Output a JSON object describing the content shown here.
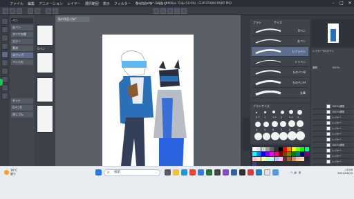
{
  "window": {
    "title": "私の作品.clip* (1600 x 1600px 72dpi 50.0%) - CLIP STUDIO PAINT PRO",
    "menu": [
      "ファイル",
      "編集",
      "アニメーション",
      "レイヤー",
      "選択範囲",
      "表示",
      "フィルター",
      "ウィンドウ",
      "ヘルプ"
    ],
    "minimize": "–",
    "maximize": "□",
    "close": "✕"
  },
  "subtool": {
    "header": "ペン",
    "items": [
      "丸ペン",
      "すべての種",
      "カラー",
      "素材",
      "スワップ",
      "ペン入れ",
      "セット",
      "GペンK",
      "消しゴム"
    ]
  },
  "brush_preview_labels": [
    "Gペン"
  ],
  "canvas": {
    "tab_label": "私の作品.clip*"
  },
  "brush_panel": {
    "tabs": [
      "ブラシ",
      "サイズ"
    ],
    "entries": [
      "Gペン",
      "丸ペン",
      "カブラペン",
      "ミリペン",
      "ものペンB",
      "ものペンH",
      "丸筆"
    ],
    "selected_index": 2
  },
  "brush_size": {
    "header": "ブラシサイズ",
    "sizes": [
      "0.7",
      "1",
      "1.5",
      "2",
      "2.5",
      "3",
      "4",
      "5",
      "6",
      "7",
      "8",
      "10",
      "12",
      "15",
      "17",
      "20",
      "25",
      "30"
    ]
  },
  "layer_panel": {
    "header": "レイヤープロパティ",
    "blend": "通常",
    "opacity": "100 %",
    "layers": [
      "100 %通常",
      "100 %通常",
      "レイヤー",
      "レイヤー",
      "レイヤー",
      "レイヤー",
      "レイヤー",
      "100 %通常",
      "レイヤー",
      "レイヤー",
      "レイヤー",
      "100 %通常",
      "100 %通常"
    ]
  },
  "palette_colors": [
    "#ffffff",
    "#e6e6e6",
    "#cccccc",
    "#999999",
    "#666666",
    "#333333",
    "#000000",
    "#ff0000",
    "#ff8000",
    "#ffff00",
    "#80ff00",
    "#00ff00",
    "#00ff80",
    "#00ffff",
    "#0080ff",
    "#0000ff",
    "#8000ff",
    "#ff00ff",
    "#ff0080",
    "#800000",
    "#804000",
    "#808000",
    "#008000",
    "#008080",
    "#000080",
    "#800080",
    "#ffc0c0",
    "#ffe0c0",
    "#ffffc0",
    "#c0ffc0",
    "#c0ffff",
    "#c0c0ff",
    "#ffc0ff",
    "#603020",
    "#a06040",
    "#d09070",
    "#f0c8a0",
    "#ffd8b0",
    "#202040",
    "#404080"
  ],
  "taskbar": {
    "weather_temp": "16°C",
    "weather_desc": "曇り",
    "search_placeholder": "検索",
    "time": "13:09",
    "date": "2021/06/29",
    "tray": "ヘ 🔊 あ"
  }
}
